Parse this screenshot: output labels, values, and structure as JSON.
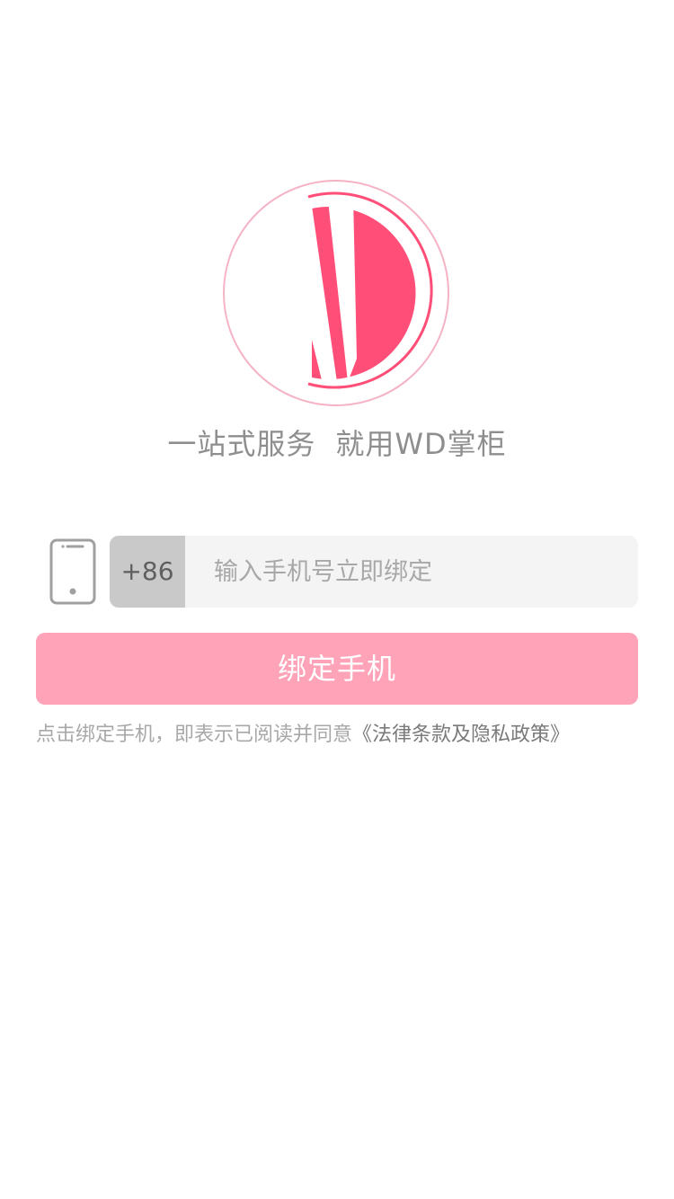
{
  "logo": {
    "letters": "WD",
    "brand_color": "#ff4f78",
    "ring_color": "#f5b3c5"
  },
  "slogan": {
    "part1": "一站式服务",
    "part2": "就用WD掌柜"
  },
  "phone": {
    "country_code": "+86",
    "input_value": "",
    "placeholder": "输入手机号立即绑定",
    "icon": "mobile-phone-icon"
  },
  "bind_button": {
    "label": "绑定手机",
    "color": "#ffa4b8"
  },
  "agreement": {
    "prefix": "点击绑定手机，即表示已阅读并同意",
    "link": "《法律条款及隐私政策》"
  }
}
